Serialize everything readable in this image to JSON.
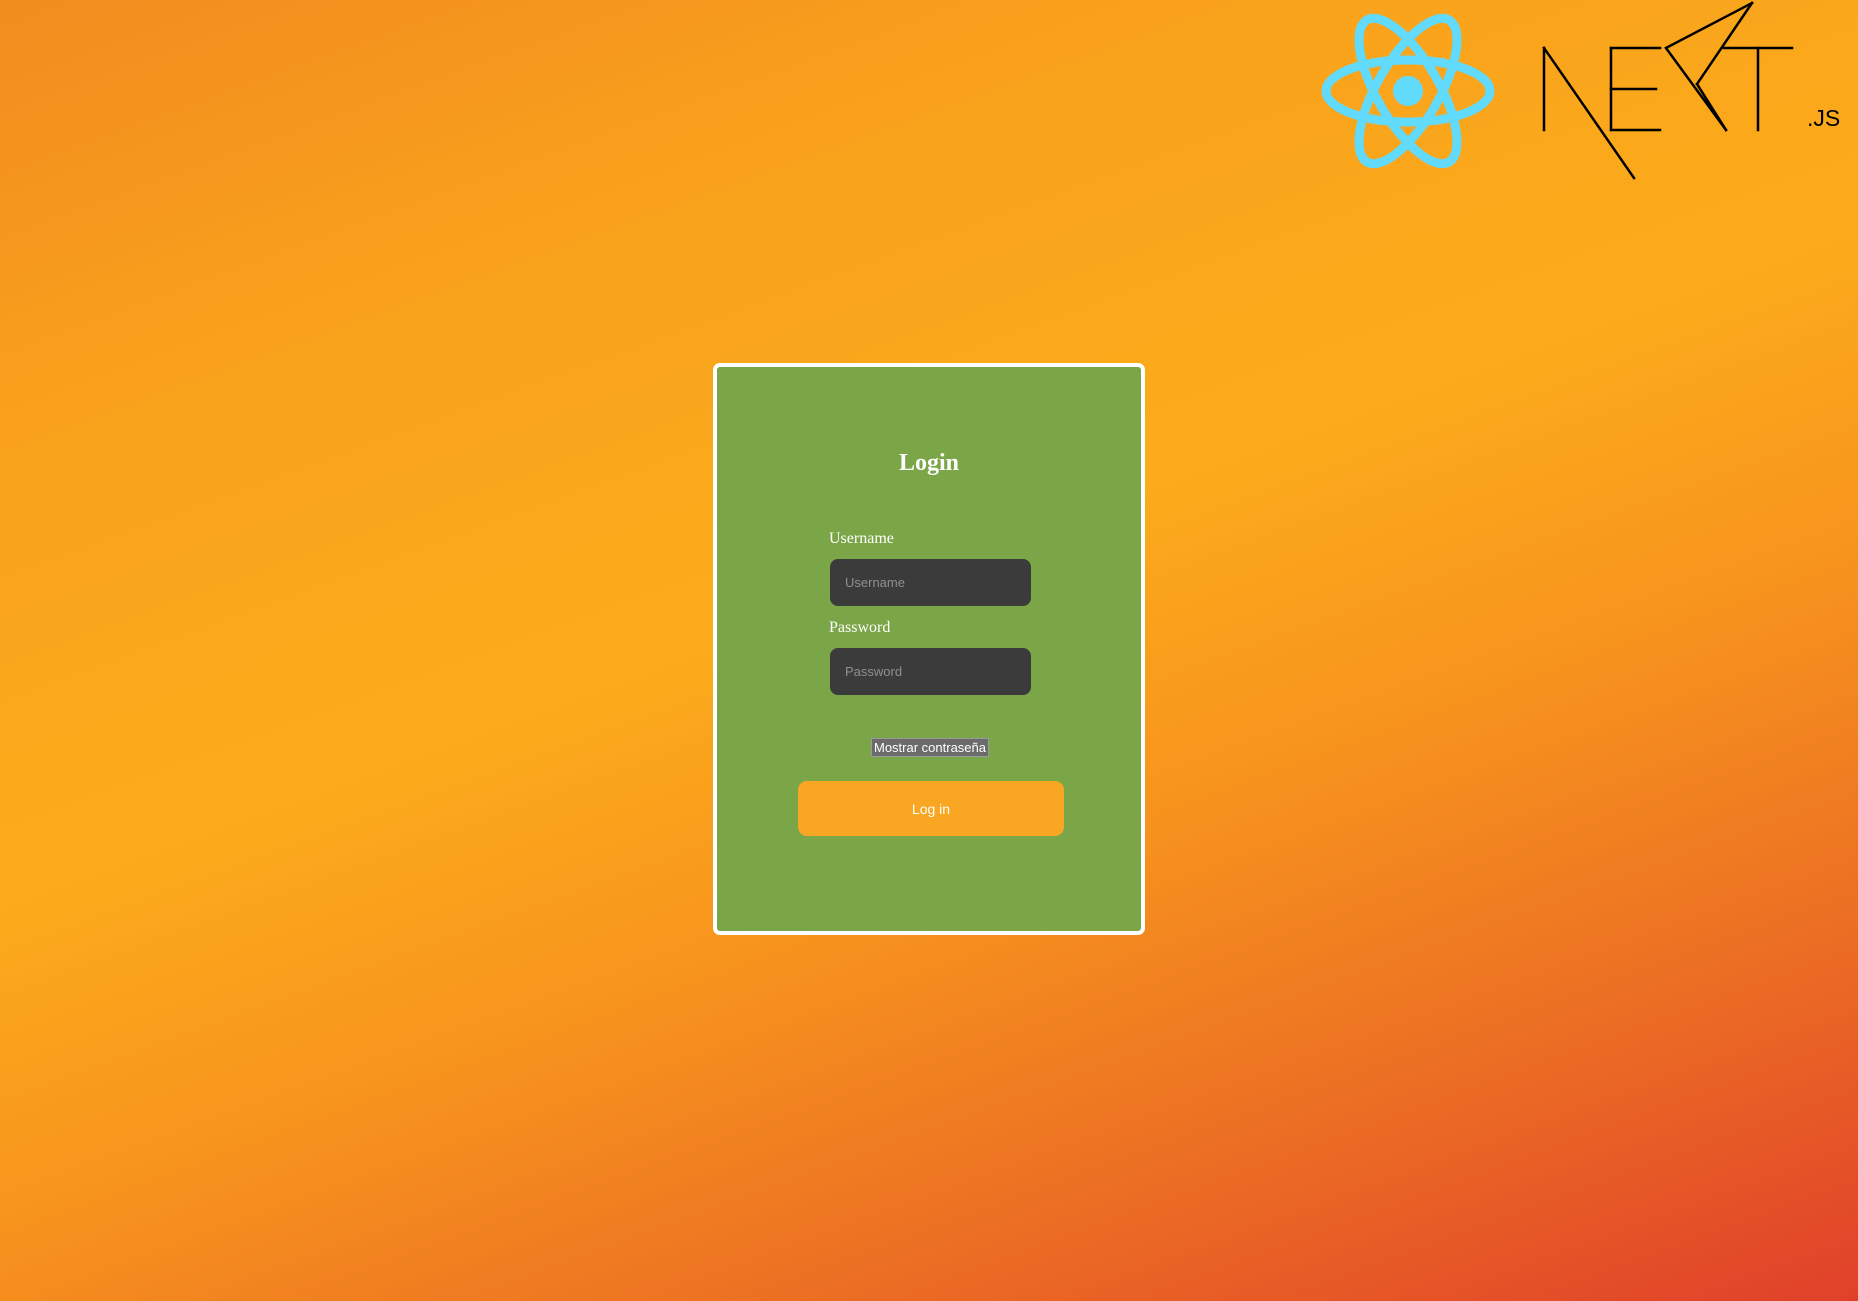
{
  "header": {
    "react_logo": {
      "icon": "react-atom-icon",
      "color": "#61dafb"
    },
    "next_logo": {
      "icon": "nextjs-wordmark-icon",
      "text": "NEXT",
      "suffix": ".JS",
      "color": "#000000"
    }
  },
  "login_form": {
    "title": "Login",
    "username": {
      "label": "Username",
      "placeholder": "Username",
      "value": ""
    },
    "password": {
      "label": "Password",
      "placeholder": "Password",
      "value": ""
    },
    "show_password_label": "Mostrar contraseña",
    "submit_label": "Log in"
  },
  "colors": {
    "card_background": "#7aa648",
    "card_border": "#ffffff",
    "input_background": "#3b3b3b",
    "button_background": "#f9a623",
    "background_gradient": [
      "#f18c1f",
      "#fcac1b",
      "#e0402a"
    ]
  }
}
